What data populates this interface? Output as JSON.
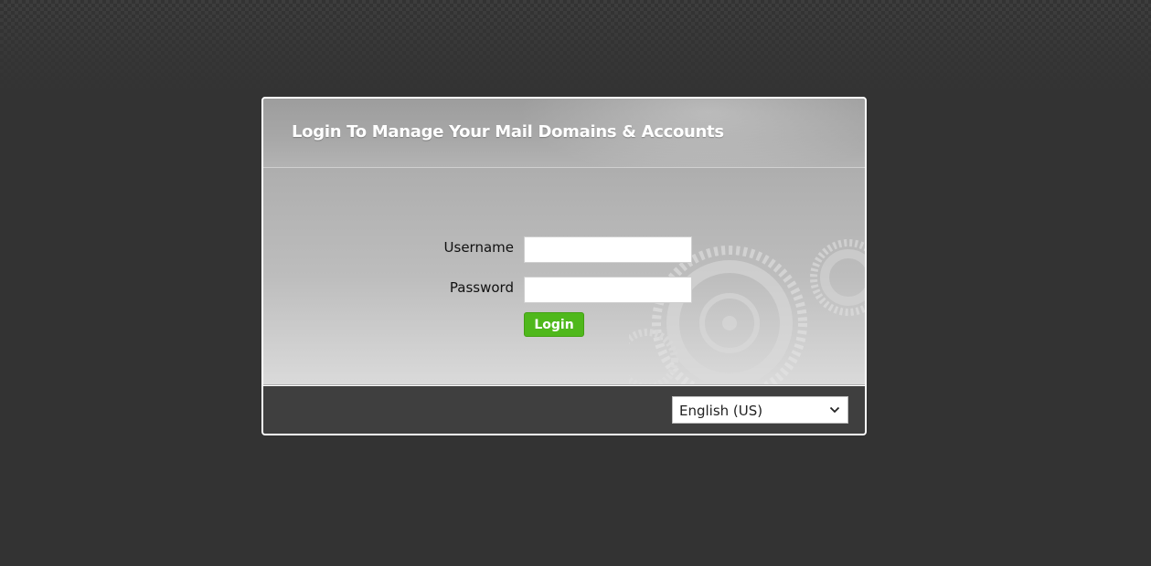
{
  "login_panel": {
    "title": "Login To Manage Your Mail Domains & Accounts",
    "username": {
      "label": "Username",
      "value": "",
      "placeholder": ""
    },
    "password": {
      "label": "Password",
      "value": "",
      "placeholder": ""
    },
    "login_button_label": "Login",
    "language_select": {
      "selected": "English (US)"
    }
  },
  "colors": {
    "page_background": "#333333",
    "panel_border": "#ffffff",
    "login_button": "#4fb81c",
    "footer_background": "#3f3f3f"
  },
  "icons": {
    "gears_decoration": "gears-icon",
    "dropdown": "chevron-down-icon"
  }
}
